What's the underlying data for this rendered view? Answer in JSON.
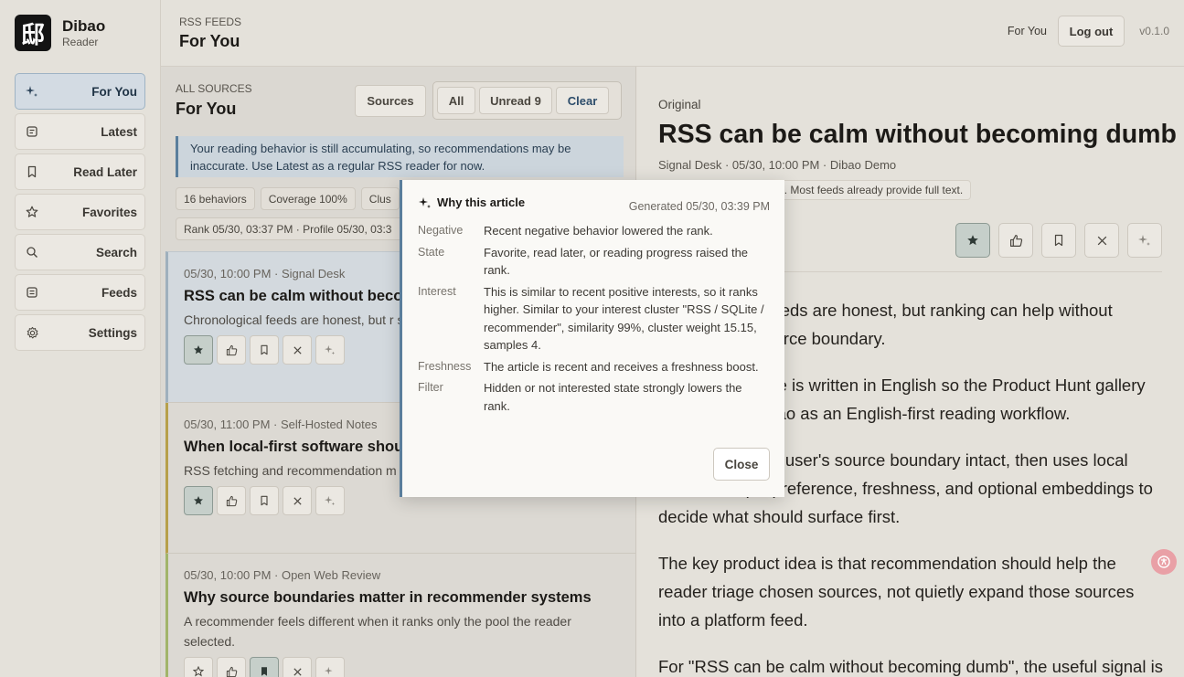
{
  "brand": {
    "logo_glyph": "邸",
    "name": "Dibao",
    "sub": "Reader"
  },
  "nav": [
    {
      "label": "For You",
      "icon": "sparkle-icon"
    },
    {
      "label": "Latest",
      "icon": "document-icon"
    },
    {
      "label": "Read Later",
      "icon": "bookmark-icon"
    },
    {
      "label": "Favorites",
      "icon": "star-icon"
    },
    {
      "label": "Search",
      "icon": "search-icon"
    },
    {
      "label": "Feeds",
      "icon": "feeds-icon"
    },
    {
      "label": "Settings",
      "icon": "gear-icon"
    }
  ],
  "header": {
    "eyebrow": "RSS FEEDS",
    "title": "For You",
    "for_you": "For You",
    "logout": "Log out",
    "version": "v0.1.0"
  },
  "list": {
    "eyebrow": "ALL SOURCES",
    "title": "For You",
    "sources_btn": "Sources",
    "filter_all": "All",
    "filter_unread": "Unread 9",
    "filter_clear": "Clear",
    "notice": "Your reading behavior is still accumulating, so recommendations may be inaccurate. Use Latest as a regular RSS reader for now.",
    "chips": [
      "16 behaviors",
      "Coverage 100%",
      "Clus"
    ],
    "rank_line": "Rank 05/30, 03:37 PM · Profile 05/30, 03:3",
    "articles": [
      {
        "meta": "05/30, 10:00 PM · Signal Desk",
        "title": "RSS can be calm without becom",
        "summary": "Chronological feeds are honest, but r source boundary."
      },
      {
        "meta": "05/30, 11:00 PM · Self-Hosted Notes",
        "title": "When local-first software shou",
        "summary": "RSS fetching and recommendation m that keeps running."
      },
      {
        "meta": "05/30, 10:00 PM · Open Web Review",
        "title": "Why source boundaries matter in recommender systems",
        "summary": "A recommender feels different when it ranks only the pool the reader selected."
      }
    ]
  },
  "reader": {
    "label": "Original",
    "title": "RSS can be calm without becoming dumb",
    "meta": "Signal Desk · 05/30, 10:00 PM · Dibao Demo",
    "note": "om the RSS / Atom feed. Most feeds already provide full text.",
    "paragraphs": [
      "Chronological feeds are honest, but ranking can help without breaking the source boundary.",
      "This demo article is written in English so the Product Hunt gallery can present Dibao as an English-first reading workflow.",
      "Dibao keeps the user's source boundary intact, then uses local behavior, topic preference, freshness, and optional embeddings to decide what should surface first.",
      "The key product idea is that recommendation should help the reader triage chosen sources, not quietly expand those sources into a platform feed.",
      "For \"RSS can be calm without becoming dumb\", the useful signal is"
    ]
  },
  "popover": {
    "title": "Why this article",
    "generated": "Generated 05/30, 03:39 PM",
    "rows": [
      {
        "k": "Negative",
        "v": "Recent negative behavior lowered the rank."
      },
      {
        "k": "State",
        "v": "Favorite, read later, or reading progress raised the rank."
      },
      {
        "k": "Interest",
        "v": "This is similar to recent positive interests, so it ranks higher. Similar to your interest cluster \"RSS / SQLite / recommender\", similarity 99%, cluster weight 15.15, samples 4."
      },
      {
        "k": "Freshness",
        "v": "The article is recent and receives a freshness boost."
      },
      {
        "k": "Filter",
        "v": "Hidden or not interested state strongly lowers the rank."
      }
    ],
    "close": "Close"
  },
  "colors": {
    "accent": "#5a7e9c",
    "active_nav": "#d3dbe3",
    "favorite_on": "#c6cfca"
  }
}
